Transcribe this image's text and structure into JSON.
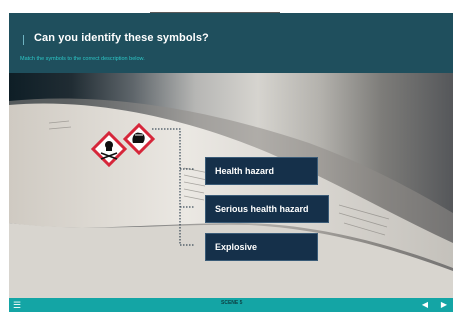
{
  "header": {
    "title": "Can you identify these symbols?",
    "subtitle": "Match the symbols to the correct description below."
  },
  "options": [
    {
      "label": "Health hazard"
    },
    {
      "label": "Serious health hazard"
    },
    {
      "label": "Explosive"
    }
  ],
  "footer": {
    "center_label": "SCENE 5",
    "left_text": "",
    "menu_icon": "menu-icon",
    "prev_icon": "prev-arrow-icon",
    "next_icon": "next-arrow-icon"
  },
  "colors": {
    "header_bg": "#1f4f5d",
    "accent": "#2cc7c7",
    "footer_bg": "#14a5a5",
    "hotspot_bg": "#15304a"
  }
}
